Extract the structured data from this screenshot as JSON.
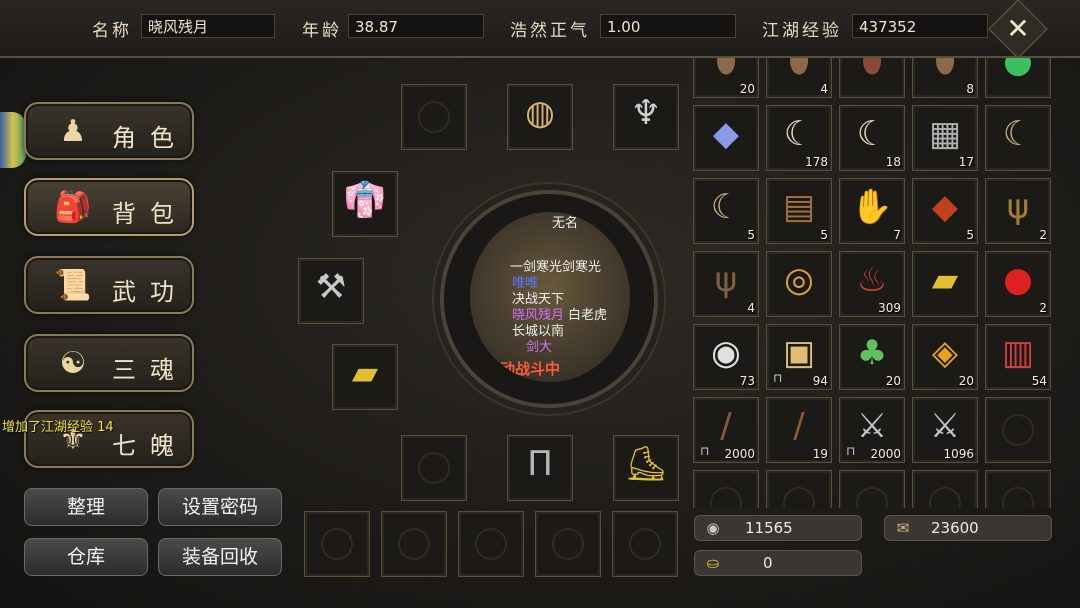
{
  "header": {
    "name_label": "名称",
    "name_value": "晓风残月",
    "age_label": "年龄",
    "age_value": "38.87",
    "righteous_label": "浩然正气",
    "righteous_value": "1.00",
    "exp_label": "江湖经验",
    "exp_value": "437352",
    "close_glyph": "✕"
  },
  "menu": [
    {
      "label": "角色",
      "icon": "figure-icon"
    },
    {
      "label": "背包",
      "icon": "backpack-icon"
    },
    {
      "label": "武功",
      "icon": "scroll-icon"
    },
    {
      "label": "三魂",
      "icon": "spirit-icon"
    },
    {
      "label": "七魄",
      "icon": "soul-icon"
    }
  ],
  "toast": "增加了江湖经验 14",
  "actions": {
    "sort": "整理",
    "set_password": "设置密码",
    "warehouse": "仓库",
    "recycle": "装备回收"
  },
  "portrait": {
    "line1": "无名",
    "line2": "一剑寒光剑寒光",
    "line3": "唯唯",
    "line4": "决战天下",
    "line5": "晓风残月",
    "line5b": "白老虎",
    "line6": "长城以南",
    "line7": "剑大",
    "banner": "动战斗中"
  },
  "bag_rows": [
    [
      "20",
      "4",
      "",
      "8",
      ""
    ],
    [
      "",
      "178",
      "18",
      "17",
      ""
    ],
    [
      "5",
      "5",
      "7",
      "5",
      "2"
    ],
    [
      "4",
      "",
      "309",
      "",
      "2"
    ],
    [
      "73",
      "94",
      "20",
      "20",
      "54"
    ],
    [
      "2000",
      "19",
      "2000",
      "1096",
      ""
    ],
    [
      "",
      "",
      "",
      "",
      ""
    ]
  ],
  "currency": {
    "coins": "11565",
    "gold_ingots": "0",
    "tokens": "23600"
  },
  "colors": {
    "accent_gold": "#b49c6c",
    "toast_yellow": "#f2e23a"
  }
}
